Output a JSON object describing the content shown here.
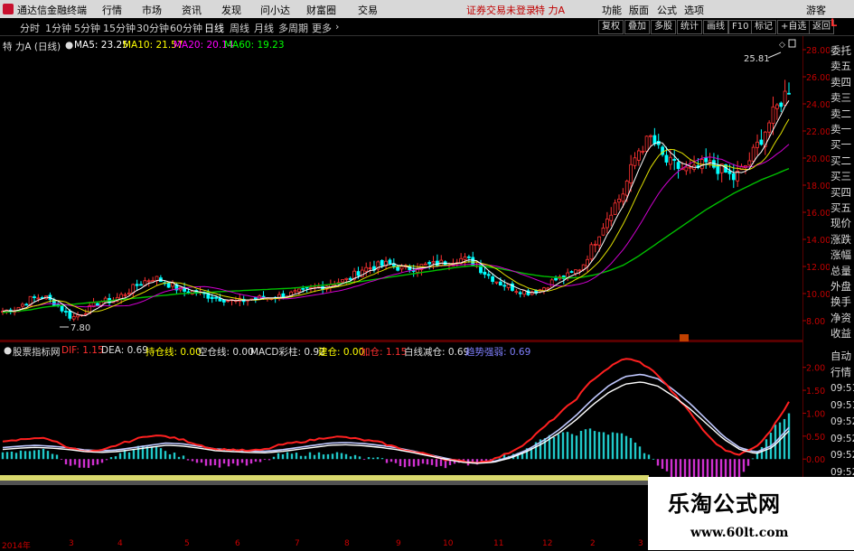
{
  "menubar": {
    "app_title": "通达信金融终端",
    "menus": [
      "行情",
      "市场",
      "资讯",
      "发现",
      "问小达",
      "财富圈",
      "交易"
    ],
    "status": "证券交易未登录",
    "stock_name": "特 力A",
    "right_items": [
      "功能",
      "版面",
      "公式",
      "选项"
    ],
    "guest": "游客"
  },
  "periodbar": {
    "periods": [
      "分时",
      "1分钟",
      "5分钟",
      "15分钟",
      "30分钟",
      "60分钟",
      "日线",
      "周线",
      "月线",
      "多周期",
      "更多"
    ],
    "active": "日线",
    "right_buttons": [
      "复权",
      "叠加",
      "多股",
      "统计",
      "画线",
      "F10",
      "标记",
      "+自选",
      "返回"
    ]
  },
  "main": {
    "title": "特 力A (日线)",
    "ma": [
      {
        "label": "MA5: 23.25",
        "color": "#ffffff"
      },
      {
        "label": "MA10: 21.57",
        "color": "#ffff00"
      },
      {
        "label": "MA20: 20.14",
        "color": "#ff00ff"
      },
      {
        "label": "MA60: 19.23",
        "color": "#00ff00"
      }
    ],
    "high_label": "25.81",
    "low_label": "7.80",
    "yticks": [
      "28.00",
      "26.00",
      "24.00",
      "22.00",
      "20.00",
      "18.00",
      "16.00",
      "14.00",
      "12.00",
      "10.00",
      "8.00"
    ],
    "ymin": 7.0,
    "ymax": 28.6
  },
  "macd": {
    "indicator_label": "股票指标网",
    "items": [
      {
        "label": "DIF: 1.15",
        "color": "#ff3030"
      },
      {
        "label": "DEA: 0.69",
        "color": "#e0e0e0"
      },
      {
        "label": "持仓线: 0.00",
        "color": "#ffff00"
      },
      {
        "label": "空仓线: 0.00",
        "color": "#e0e0e0"
      },
      {
        "label": "MACD彩柱: 0.92",
        "color": "#e0e0e0"
      },
      {
        "label": "建仓: 0.00",
        "color": "#ffff00"
      },
      {
        "label": "加仓: 1.15",
        "color": "#ff3030"
      },
      {
        "label": "白线减仓: 0.69",
        "color": "#e0e0e0"
      },
      {
        "label": "趋势强弱: 0.69",
        "color": "#8080ff"
      }
    ],
    "yticks": [
      "2.00",
      "1.50",
      "1.00",
      "0.50",
      "0.00"
    ]
  },
  "side": {
    "corner": "L",
    "items": [
      "委托",
      "卖五",
      "卖四",
      "卖三",
      "卖二",
      "卖一",
      "买一",
      "买二",
      "买三",
      "买四",
      "买五",
      "现价",
      "涨跌",
      "涨幅",
      "总量",
      "外盘",
      "换手",
      "净资",
      "收益"
    ],
    "bottom_items": [
      "自动",
      "行情"
    ],
    "times": [
      "09:51",
      "09:51",
      "09:52",
      "09:52",
      "09:52",
      "09:52",
      "09:52"
    ]
  },
  "dateaxis": {
    "labels": [
      "2014年",
      "3",
      "4",
      "5",
      "6",
      "7",
      "8",
      "9",
      "10",
      "11",
      "12",
      "2",
      "3"
    ]
  },
  "watermark": {
    "line1": "乐淘公式网",
    "line2": "www.60lt.com"
  },
  "colors": {
    "up": "#ff3232",
    "down": "#00ffff",
    "axis": "#b00000",
    "ma60": "#00c000"
  },
  "chart_data": {
    "type": "candlestick",
    "close": [
      8.7,
      8.9,
      9.6,
      9.8,
      9.1,
      8.2,
      8.7,
      9.4,
      9.5,
      10.1,
      10.8,
      11.2,
      10.7,
      10.2,
      10.1,
      9.8,
      9.6,
      9.4,
      9.6,
      9.7,
      9.8,
      10.0,
      10.2,
      10.5,
      10.8,
      11.0,
      11.8,
      12.0,
      12.2,
      11.8,
      12.0,
      12.1,
      12.3,
      12.6,
      12.4,
      11.5,
      10.8,
      10.4,
      10.1,
      10.3,
      11.0,
      11.3,
      12.0,
      14.0,
      16.0,
      17.5,
      20.5,
      21.5,
      19.8,
      19.3,
      19.0,
      19.6,
      19.2,
      18.5,
      19.6,
      21.5,
      23.5,
      25.2
    ],
    "ma60": [
      8.6,
      8.7,
      8.8,
      9.0,
      9.1,
      9.2,
      9.3,
      9.4,
      9.5,
      9.6,
      9.7,
      9.8,
      9.9,
      10.0,
      10.05,
      10.1,
      10.15,
      10.2,
      10.25,
      10.3,
      10.35,
      10.4,
      10.5,
      10.6,
      10.7,
      10.8,
      10.9,
      11.05,
      11.2,
      11.35,
      11.5,
      11.65,
      11.8,
      11.95,
      12.05,
      12.0,
      11.85,
      11.65,
      11.45,
      11.3,
      11.2,
      11.15,
      11.2,
      11.4,
      11.7,
      12.1,
      12.7,
      13.4,
      14.1,
      14.8,
      15.5,
      16.2,
      16.8,
      17.4,
      17.9,
      18.4,
      18.8,
      19.23
    ],
    "dif": [
      0.3,
      0.35,
      0.4,
      0.35,
      0.2,
      0.1,
      0.12,
      0.25,
      0.35,
      0.45,
      0.42,
      0.35,
      0.25,
      0.15,
      0.15,
      0.12,
      0.15,
      0.25,
      0.3,
      0.35,
      0.42,
      0.4,
      0.35,
      0.3,
      0.2,
      0.1,
      0.05,
      -0.05,
      -0.1,
      -0.12,
      -0.05,
      0.1,
      0.3,
      0.6,
      0.9,
      1.2,
      1.6,
      1.85,
      2.05,
      1.95,
      1.7,
      1.3,
      0.9,
      0.45,
      0.15,
      0.05,
      0.2,
      0.6,
      1.15
    ],
    "dea": [
      0.25,
      0.28,
      0.3,
      0.28,
      0.25,
      0.2,
      0.18,
      0.2,
      0.25,
      0.3,
      0.35,
      0.33,
      0.28,
      0.22,
      0.2,
      0.18,
      0.17,
      0.2,
      0.25,
      0.3,
      0.35,
      0.36,
      0.34,
      0.3,
      0.25,
      0.18,
      0.1,
      0.02,
      -0.05,
      -0.08,
      -0.05,
      0.05,
      0.2,
      0.4,
      0.65,
      0.95,
      1.3,
      1.6,
      1.8,
      1.85,
      1.75,
      1.5,
      1.2,
      0.85,
      0.5,
      0.25,
      0.15,
      0.3,
      0.69
    ],
    "macd_ymin": -0.35,
    "macd_ymax": 2.25
  }
}
